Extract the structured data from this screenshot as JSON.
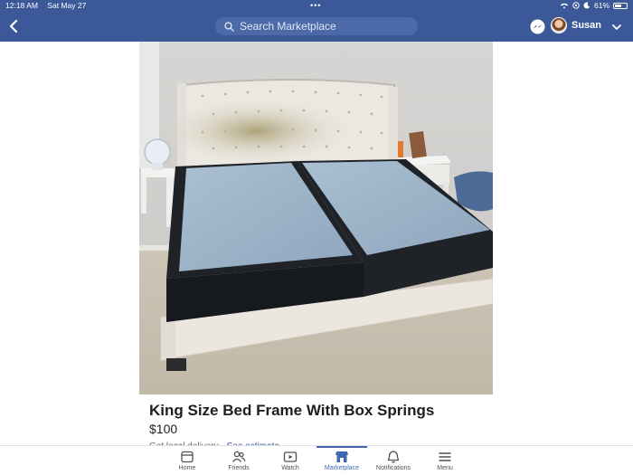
{
  "status_bar": {
    "time": "12:18 AM",
    "date": "Sat May 27",
    "battery_percent": "61%",
    "battery_level": 0.61
  },
  "header": {
    "back_icon": "chevron-left-icon",
    "search_placeholder": "Search Marketplace",
    "profile_name": "Susan",
    "messenger_icon": "messenger-icon",
    "dropdown_icon": "chevron-down-icon"
  },
  "listing": {
    "title": "King Size Bed Frame With Box Springs",
    "price": "$100",
    "delivery_text": "Get local delivery · ",
    "delivery_link": "See estimate"
  },
  "bottom_nav": {
    "items": [
      {
        "label": "Home",
        "icon": "home-icon"
      },
      {
        "label": "Friends",
        "icon": "friends-icon"
      },
      {
        "label": "Watch",
        "icon": "watch-icon"
      },
      {
        "label": "Marketplace",
        "icon": "marketplace-icon",
        "active": true
      },
      {
        "label": "Notifications",
        "icon": "bell-icon"
      },
      {
        "label": "Menu",
        "icon": "menu-icon"
      }
    ]
  },
  "colors": {
    "header_bg": "#3b5998",
    "accent": "#4267b2"
  }
}
